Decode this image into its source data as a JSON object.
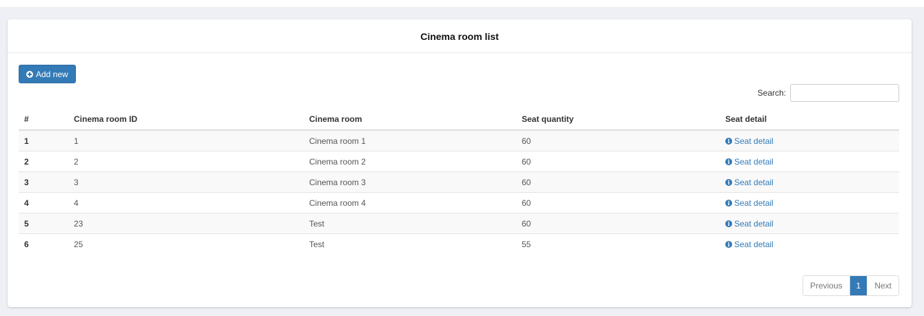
{
  "panel": {
    "title": "Cinema room list"
  },
  "toolbar": {
    "add_label": "Add new",
    "search_label": "Search:",
    "search_value": "",
    "search_placeholder": ""
  },
  "table": {
    "columns": [
      "#",
      "Cinema room ID",
      "Cinema room",
      "Seat quantity",
      "Seat detail"
    ],
    "rows": [
      {
        "num": "1",
        "id": "1",
        "room": "Cinema room 1",
        "seats": "60",
        "detail": "Seat detail"
      },
      {
        "num": "2",
        "id": "2",
        "room": "Cinema room 2",
        "seats": "60",
        "detail": "Seat detail"
      },
      {
        "num": "3",
        "id": "3",
        "room": "Cinema room 3",
        "seats": "60",
        "detail": "Seat detail"
      },
      {
        "num": "4",
        "id": "4",
        "room": "Cinema room 4",
        "seats": "60",
        "detail": "Seat detail"
      },
      {
        "num": "5",
        "id": "23",
        "room": "Test",
        "seats": "60",
        "detail": "Seat detail"
      },
      {
        "num": "6",
        "id": "25",
        "room": "Test",
        "seats": "55",
        "detail": "Seat detail"
      }
    ]
  },
  "pagination": {
    "previous": "Previous",
    "current": "1",
    "next": "Next"
  },
  "icons": {
    "add": "plus-circle-icon",
    "detail": "info-circle-icon"
  },
  "colors": {
    "primary": "#337ab7",
    "page_background": "#eef0f5"
  }
}
